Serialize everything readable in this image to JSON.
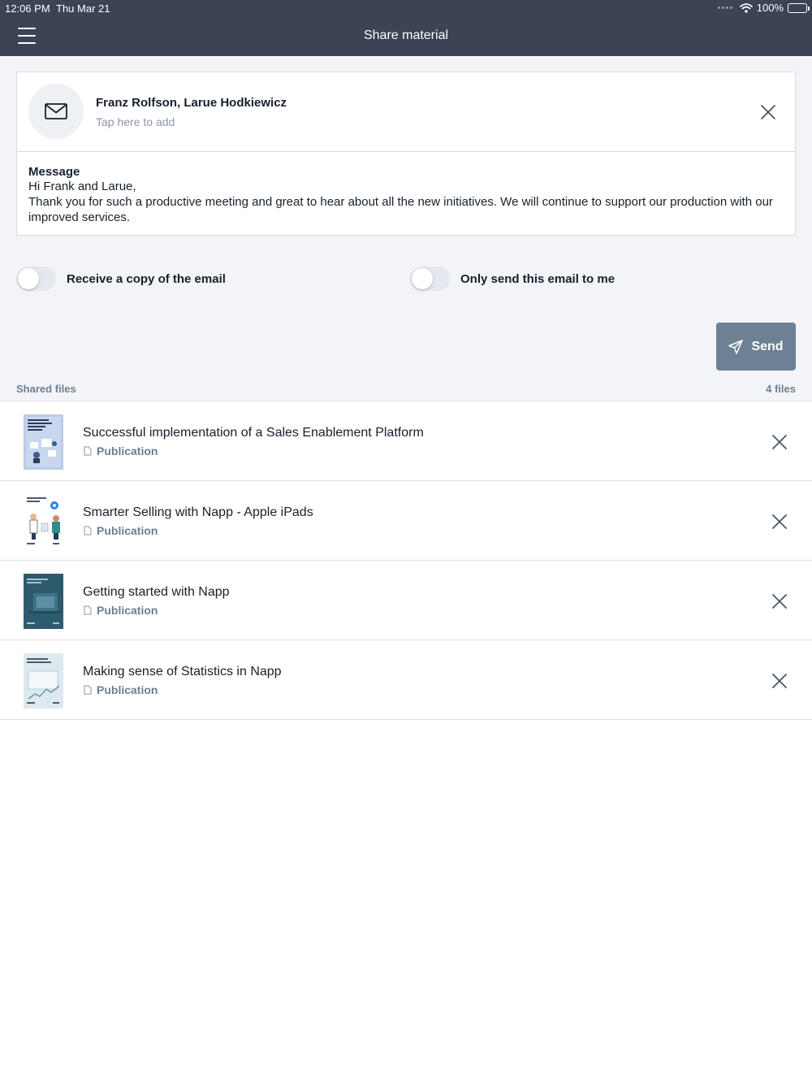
{
  "status_bar": {
    "time": "12:06 PM",
    "date": "Thu Mar 21",
    "battery": "100%"
  },
  "header": {
    "title": "Share material"
  },
  "recipients": {
    "names": "Franz Rolfson, Larue Hodkiewicz",
    "hint": "Tap here to add"
  },
  "message": {
    "label": "Message",
    "text": "Hi Frank and Larue,\nThank you for such a productive meeting and great to hear about all the new initiatives. We will continue to support our production with our improved services."
  },
  "options": {
    "copy_label": "Receive a copy of the email",
    "copy_enabled": false,
    "only_me_label": "Only send this email to me",
    "only_me_enabled": false
  },
  "send": {
    "label": "Send"
  },
  "shared_files": {
    "title": "Shared files",
    "count": "4 files",
    "items": [
      {
        "title": "Successful implementation of a Sales Enablement Platform",
        "type": "Publication"
      },
      {
        "title": "Smarter Selling with Napp - Apple iPads",
        "type": "Publication"
      },
      {
        "title": "Getting started with Napp",
        "type": "Publication"
      },
      {
        "title": "Making sense of Statistics in Napp",
        "type": "Publication"
      }
    ]
  },
  "colors": {
    "nav": "#3b4354",
    "accent": "#6d8094",
    "muted": "#6d7e91",
    "background": "#f2f4f8"
  }
}
